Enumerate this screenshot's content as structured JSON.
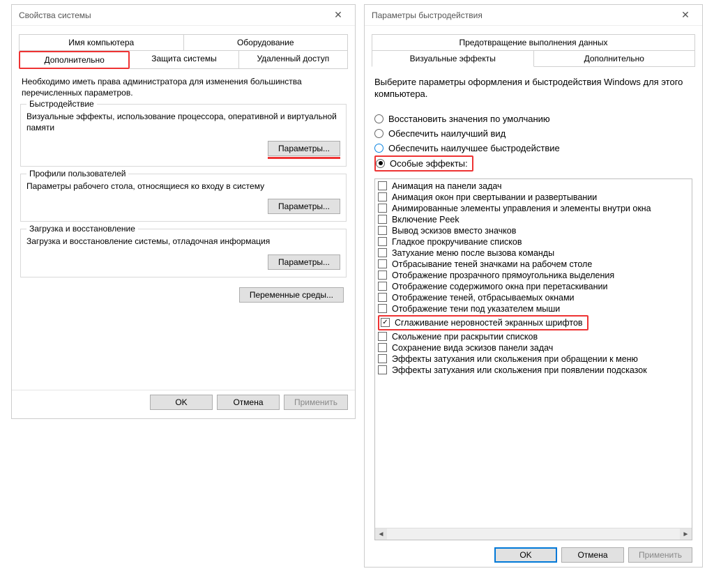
{
  "win1": {
    "title": "Свойства системы",
    "tabs_row1": [
      "Имя компьютера",
      "Оборудование"
    ],
    "tabs_row2": [
      "Дополнительно",
      "Защита системы",
      "Удаленный доступ"
    ],
    "note": "Необходимо иметь права администратора для изменения большинства перечисленных параметров.",
    "groups": [
      {
        "title": "Быстродействие",
        "desc": "Визуальные эффекты, использование процессора, оперативной и виртуальной памяти",
        "button": "Параметры...",
        "highlight": true
      },
      {
        "title": "Профили пользователей",
        "desc": "Параметры рабочего стола, относящиеся ко входу в систему",
        "button": "Параметры...",
        "highlight": false
      },
      {
        "title": "Загрузка и восстановление",
        "desc": "Загрузка и восстановление системы, отладочная информация",
        "button": "Параметры...",
        "highlight": false
      }
    ],
    "env_button": "Переменные среды...",
    "footer": {
      "ok": "OK",
      "cancel": "Отмена",
      "apply": "Применить"
    }
  },
  "win2": {
    "title": "Параметры быстродействия",
    "tabs_row1": [
      "Предотвращение выполнения данных"
    ],
    "tabs_row2": [
      "Визуальные эффекты",
      "Дополнительно"
    ],
    "intro": "Выберите параметры оформления и быстродействия Windows для этого компьютера.",
    "radios": [
      {
        "label": "Восстановить значения по умолчанию",
        "selected": false
      },
      {
        "label": "Обеспечить наилучший вид",
        "selected": false
      },
      {
        "label": "Обеспечить наилучшее быстродействие",
        "selected": false,
        "blue": true
      },
      {
        "label": "Особые эффекты:",
        "selected": true,
        "highlight": true
      }
    ],
    "effects": [
      {
        "label": "Анимация на панели задач",
        "checked": false
      },
      {
        "label": "Анимация окон при свертывании и развертывании",
        "checked": false
      },
      {
        "label": "Анимированные элементы управления и элементы внутри окна",
        "checked": false
      },
      {
        "label": "Включение Peek",
        "checked": false
      },
      {
        "label": "Вывод эскизов вместо значков",
        "checked": false
      },
      {
        "label": "Гладкое прокручивание списков",
        "checked": false
      },
      {
        "label": "Затухание меню после вызова команды",
        "checked": false
      },
      {
        "label": "Отбрасывание теней значками на рабочем столе",
        "checked": false
      },
      {
        "label": "Отображение прозрачного прямоугольника выделения",
        "checked": false
      },
      {
        "label": "Отображение содержимого окна при перетаскивании",
        "checked": false
      },
      {
        "label": "Отображение теней, отбрасываемых окнами",
        "checked": false
      },
      {
        "label": "Отображение тени под указателем мыши",
        "checked": false
      },
      {
        "label": "Сглаживание неровностей экранных шрифтов",
        "checked": true,
        "highlight": true
      },
      {
        "label": "Скольжение при раскрытии списков",
        "checked": false
      },
      {
        "label": "Сохранение вида эскизов панели задач",
        "checked": false
      },
      {
        "label": "Эффекты затухания или скольжения при обращении к меню",
        "checked": false
      },
      {
        "label": "Эффекты затухания или скольжения при появлении подсказок",
        "checked": false
      }
    ],
    "footer": {
      "ok": "OK",
      "cancel": "Отмена",
      "apply": "Применить"
    }
  }
}
